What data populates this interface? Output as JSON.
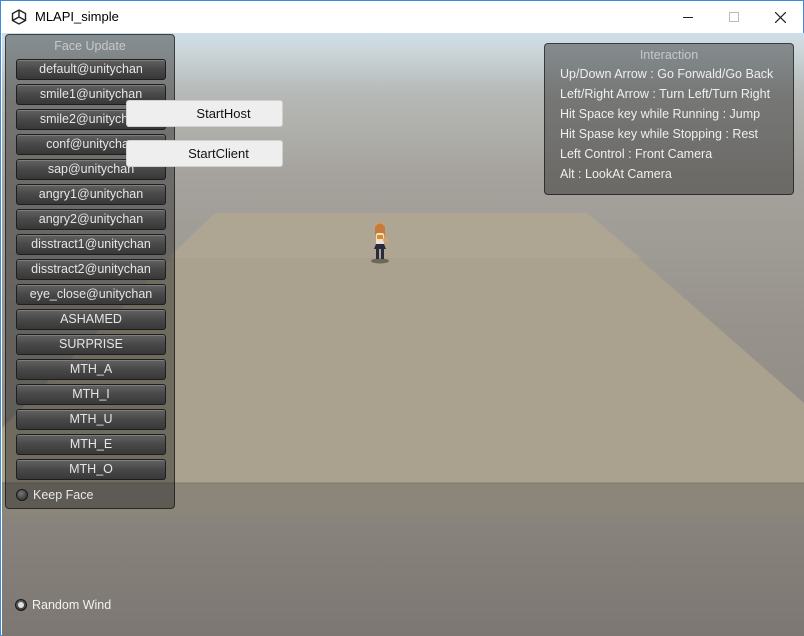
{
  "window": {
    "title": "MLAPI_simple"
  },
  "face_panel": {
    "title": "Face Update",
    "buttons": [
      "default@unitychan",
      "smile1@unitychan",
      "smile2@unitychan",
      "conf@unitychan",
      "sap@unitychan",
      "angry1@unitychan",
      "angry2@unitychan",
      "disstract1@unitychan",
      "disstract2@unitychan",
      "eye_close@unitychan",
      "ASHAMED",
      "SURPRISE",
      "MTH_A",
      "MTH_I",
      "MTH_U",
      "MTH_E",
      "MTH_O"
    ],
    "keep_face_label": "Keep Face",
    "keep_face_checked": false
  },
  "network": {
    "start_host_label": "StartHost",
    "start_client_label": "StartClient"
  },
  "interaction": {
    "title": "Interaction",
    "lines": [
      "Up/Down Arrow : Go Forwald/Go Back",
      "Left/Right Arrow : Turn Left/Turn Right",
      "Hit Space key while Running : Jump",
      "Hit Spase key while Stopping : Rest",
      "Left Control : Front Camera",
      "Alt : LookAt Camera"
    ]
  },
  "random_wind": {
    "label": "Random Wind",
    "checked": true
  },
  "icons": {
    "app": "unity-logo-icon",
    "minimize": "minimize-icon",
    "maximize": "maximize-icon",
    "close": "close-icon"
  }
}
